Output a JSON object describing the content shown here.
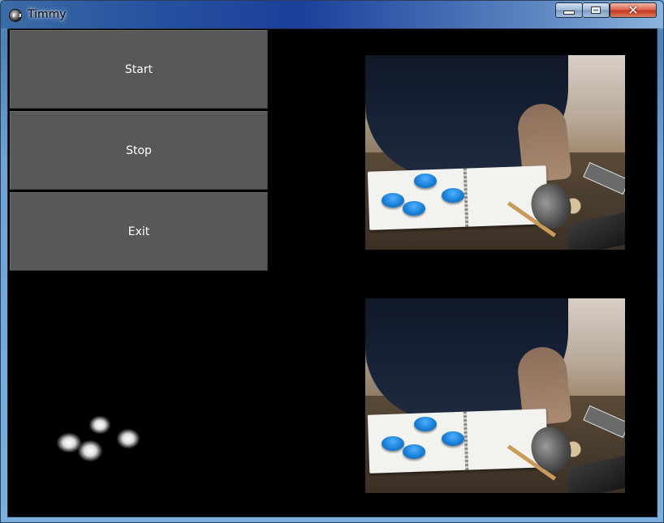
{
  "window": {
    "title": "Timmy",
    "controls": {
      "minimize_icon": "minimize-icon",
      "maximize_icon": "maximize-icon",
      "close_icon": "close-icon",
      "close_glyph": "✕"
    }
  },
  "buttons": {
    "start_label": "Start",
    "stop_label": "Stop",
    "exit_label": "Exit"
  },
  "views": {
    "camera_top": "camera-feed",
    "camera_bottom": "processed-feed",
    "mask": "threshold-mask"
  },
  "colors": {
    "client_background": "#000000",
    "button_background": "#585858",
    "button_text": "#ffffff",
    "marker_blue": "#1a7fd6"
  }
}
